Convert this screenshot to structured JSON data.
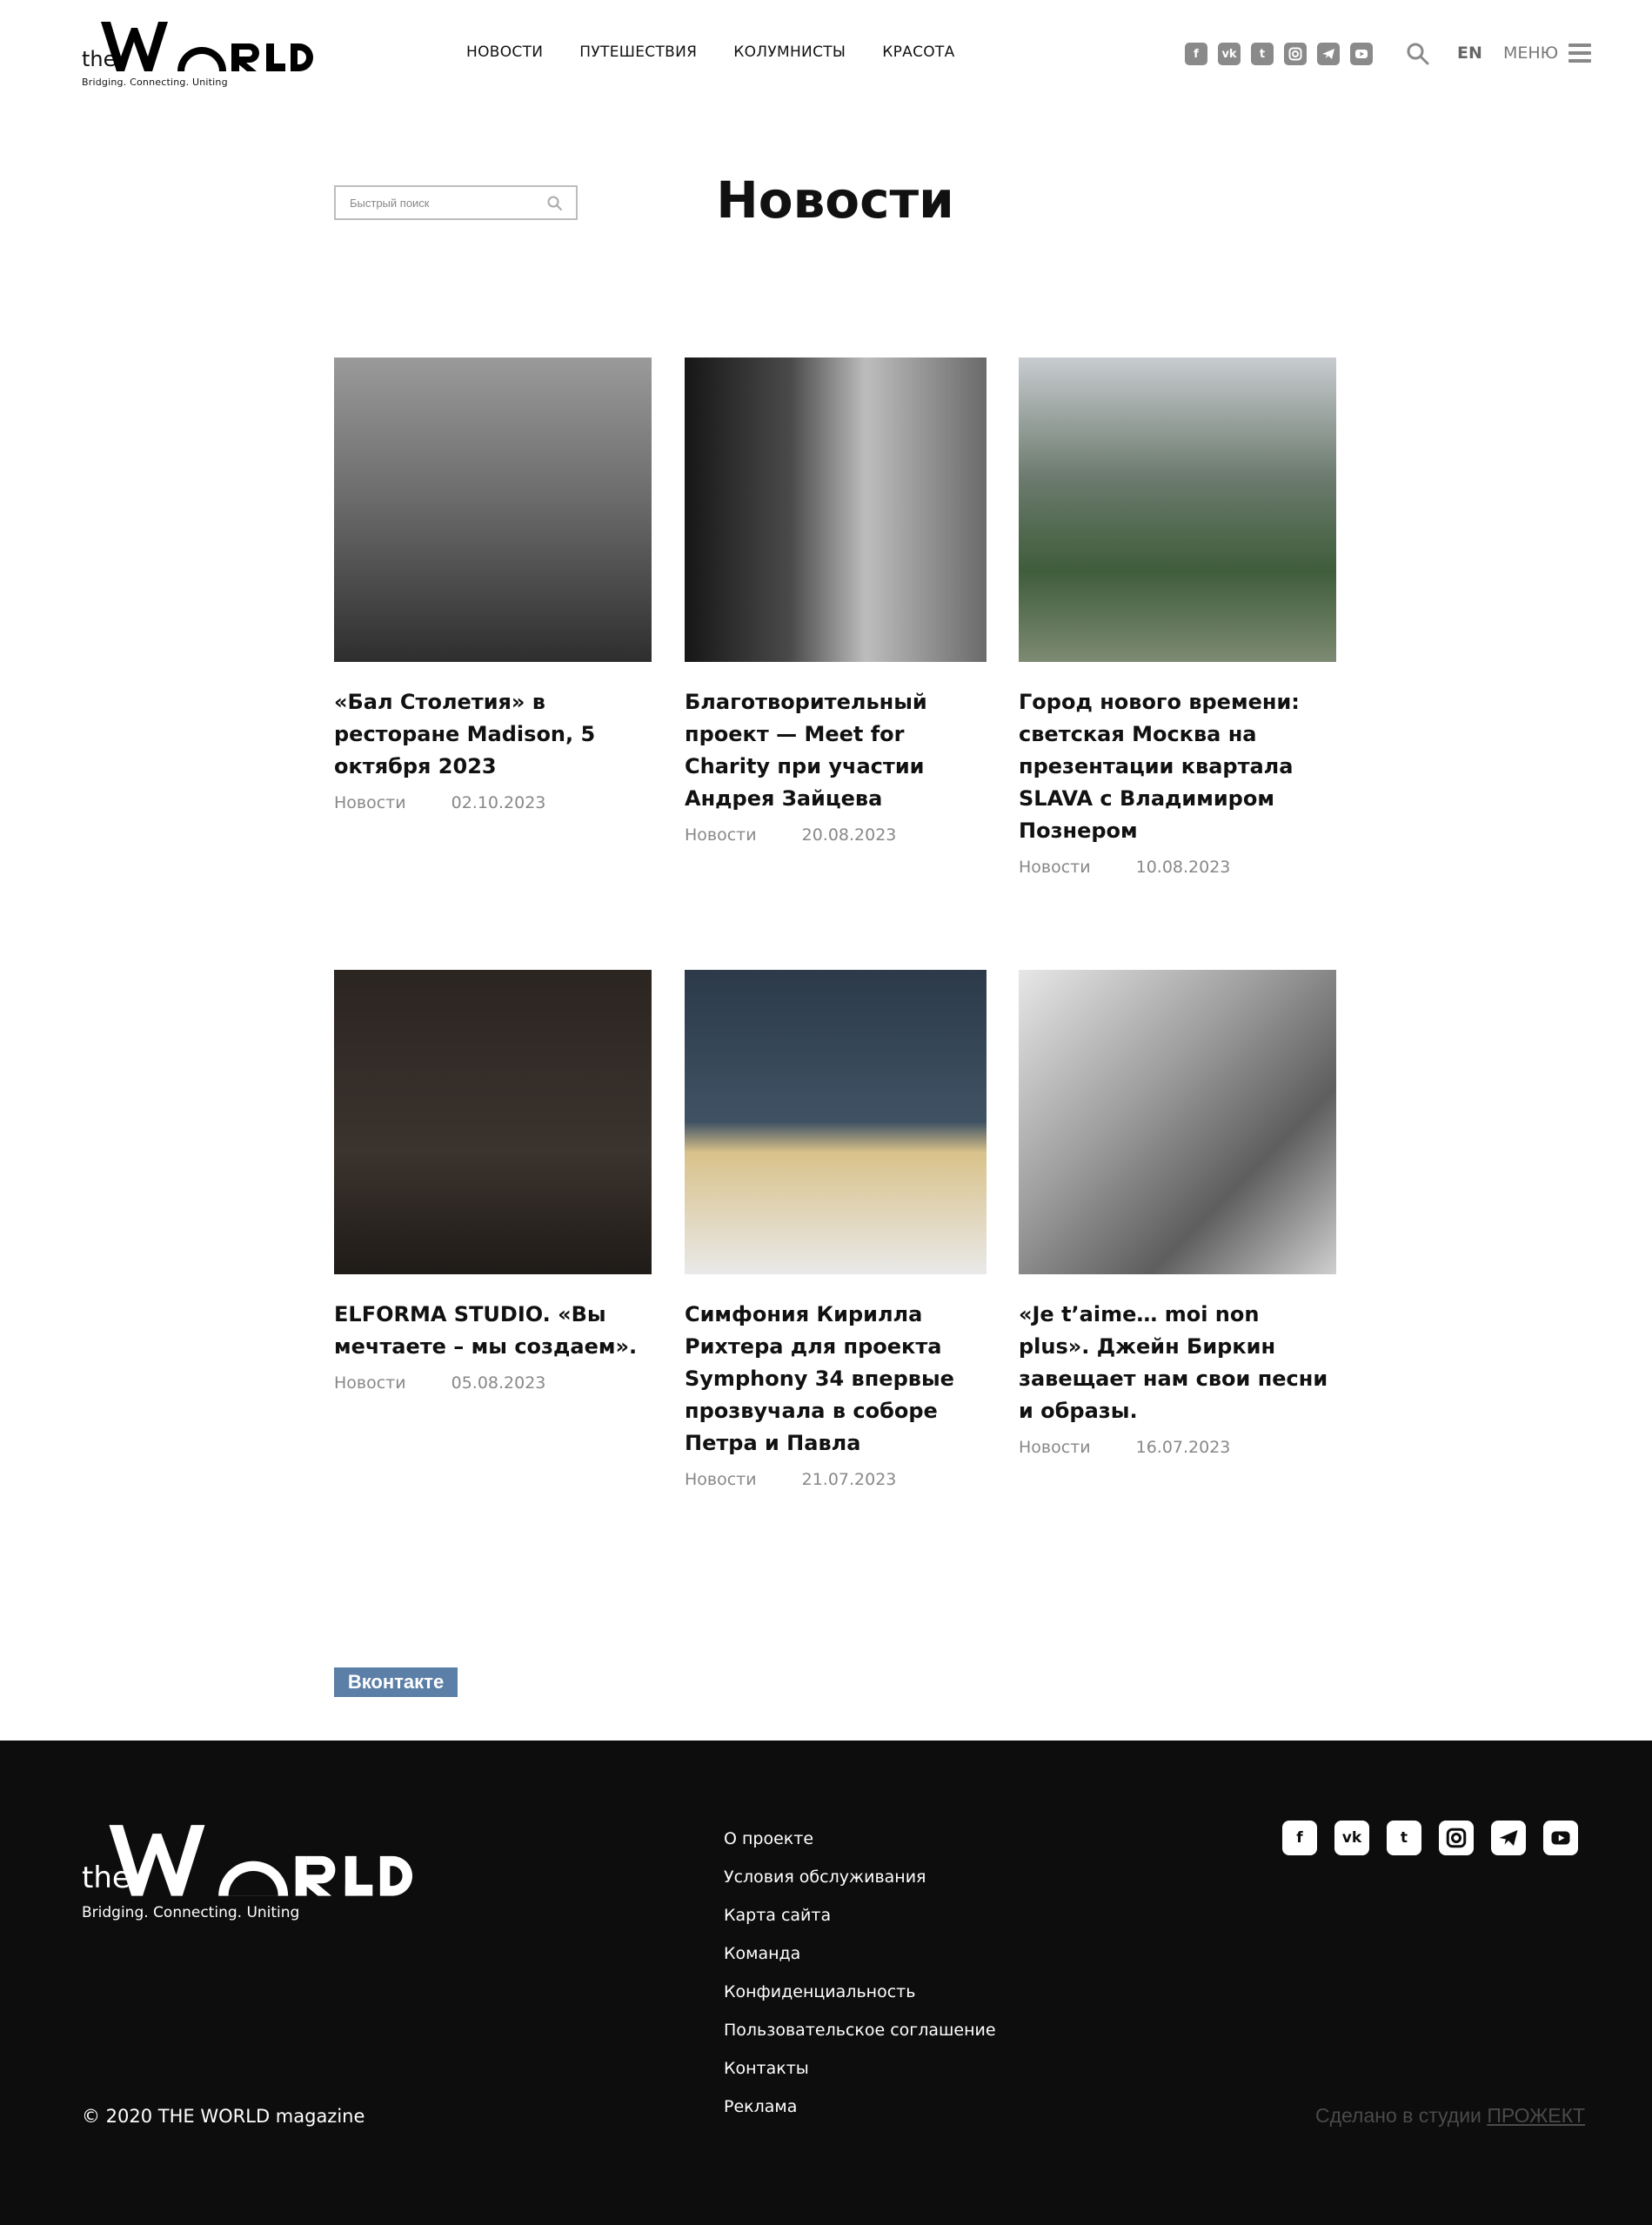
{
  "brand": {
    "logo_the": "the",
    "logo_world": "WORLD",
    "tagline": "Bridging. Connecting. Uniting"
  },
  "topnav": [
    "НОВОСТИ",
    "ПУТЕШЕСТВИЯ",
    "КОЛУМНИСТЫ",
    "КРАСОТА"
  ],
  "header": {
    "socials": [
      "facebook-icon",
      "vk-icon",
      "twitter-icon",
      "instagram-icon",
      "telegram-icon",
      "youtube-icon"
    ],
    "lang": "EN",
    "menu_label": "МЕНЮ"
  },
  "search": {
    "placeholder": "Быстрый поиск"
  },
  "page_title": "Новости",
  "articles": [
    {
      "title": "«Бал Столетия» в ресторане Madison, 5 октября 2023",
      "category": "Новости",
      "date": "02.10.2023"
    },
    {
      "title": "Благотворительный проект — Meet for Charity при участии Андрея Зайцева",
      "category": "Новости",
      "date": "20.08.2023"
    },
    {
      "title": "Город нового времени: светская Москва на презентации квартала SLAVA с Владимиром Познером",
      "category": "Новости",
      "date": "10.08.2023"
    },
    {
      "title": "ELFORMA STUDIO. «Вы мечтаете – мы создаем».",
      "category": "Новости",
      "date": "05.08.2023"
    },
    {
      "title": "Симфония Кирилла Рихтера для проекта Symphony 34 впервые прозвучала в соборе Петра и Павла",
      "category": "Новости",
      "date": "21.07.2023"
    },
    {
      "title": "«Je t’aime… moi non plus». Джейн Биркин завещает нам свои песни и образы.",
      "category": "Новости",
      "date": "16.07.2023"
    }
  ],
  "vk_button": "Вконтакте",
  "footer": {
    "links": [
      "О проекте",
      "Условия обслуживания",
      "Карта сайта",
      "Команда",
      "Конфиденциальность",
      "Пользовательское соглашение",
      "Контакты",
      "Реклама"
    ],
    "socials": [
      "facebook-icon",
      "vk-icon",
      "twitter-icon",
      "instagram-icon",
      "telegram-icon",
      "youtube-icon"
    ],
    "copyright": "© 2020 THE WORLD magazine",
    "made_by": "Сделано в студии",
    "studio": "ПРОЖЕКТ"
  },
  "colors": {
    "footer_bg": "#0d0d0d",
    "vk_blue": "#5b7fa6",
    "meta_gray": "#888888"
  }
}
